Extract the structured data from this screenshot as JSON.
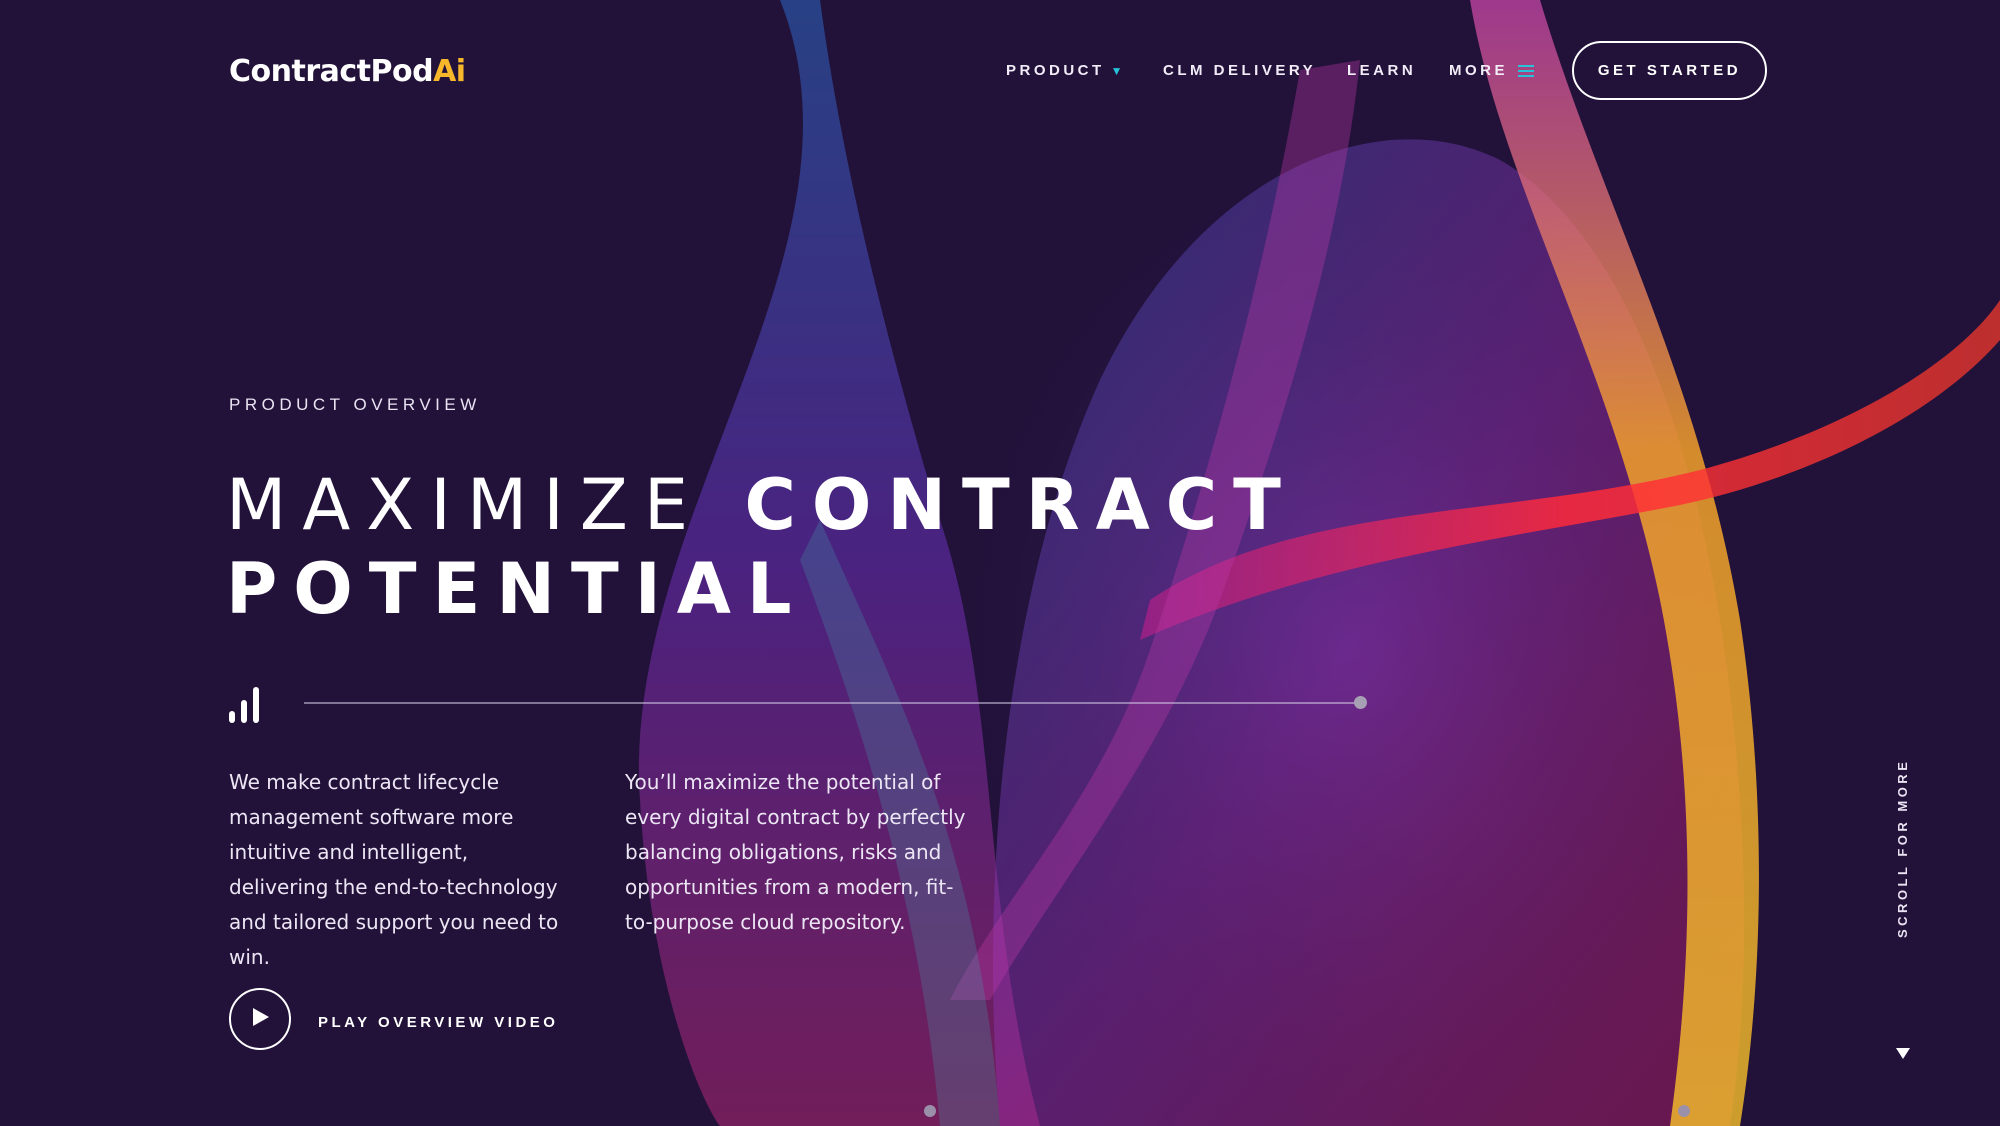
{
  "brand": {
    "name_main": "ContractPod",
    "name_accent": "Ai",
    "accent_color": "#f6b72a"
  },
  "nav": {
    "items": [
      {
        "label": "PRODUCT",
        "icon": "caret-down-icon"
      },
      {
        "label": "CLM DELIVERY"
      },
      {
        "label": "LEARN"
      },
      {
        "label": "MORE",
        "icon": "hamburger-menu-icon"
      }
    ],
    "cta_label": "GET STARTED",
    "icon_color": "#27c1d9"
  },
  "hero": {
    "eyebrow": "PRODUCT OVERVIEW",
    "headline_light": "MAXIMIZE",
    "headline_bold_1": "CONTRACT",
    "headline_bold_2": "POTENTIAL",
    "paragraph_left": "We make contract lifecycle management software more intuitive and intelligent, delivering the end-to-technology and tailored support you need to win.",
    "paragraph_right": "You’ll maximize the potential of every digital contract by perfectly balancing obligations, risks and opportunities from a modern, fit-to-purpose cloud repository.",
    "play_label": "PLAY OVERVIEW VIDEO"
  },
  "scroll": {
    "label": "SCROLL FOR MORE"
  },
  "colors": {
    "background": "#22123a",
    "text": "#ffffff"
  }
}
